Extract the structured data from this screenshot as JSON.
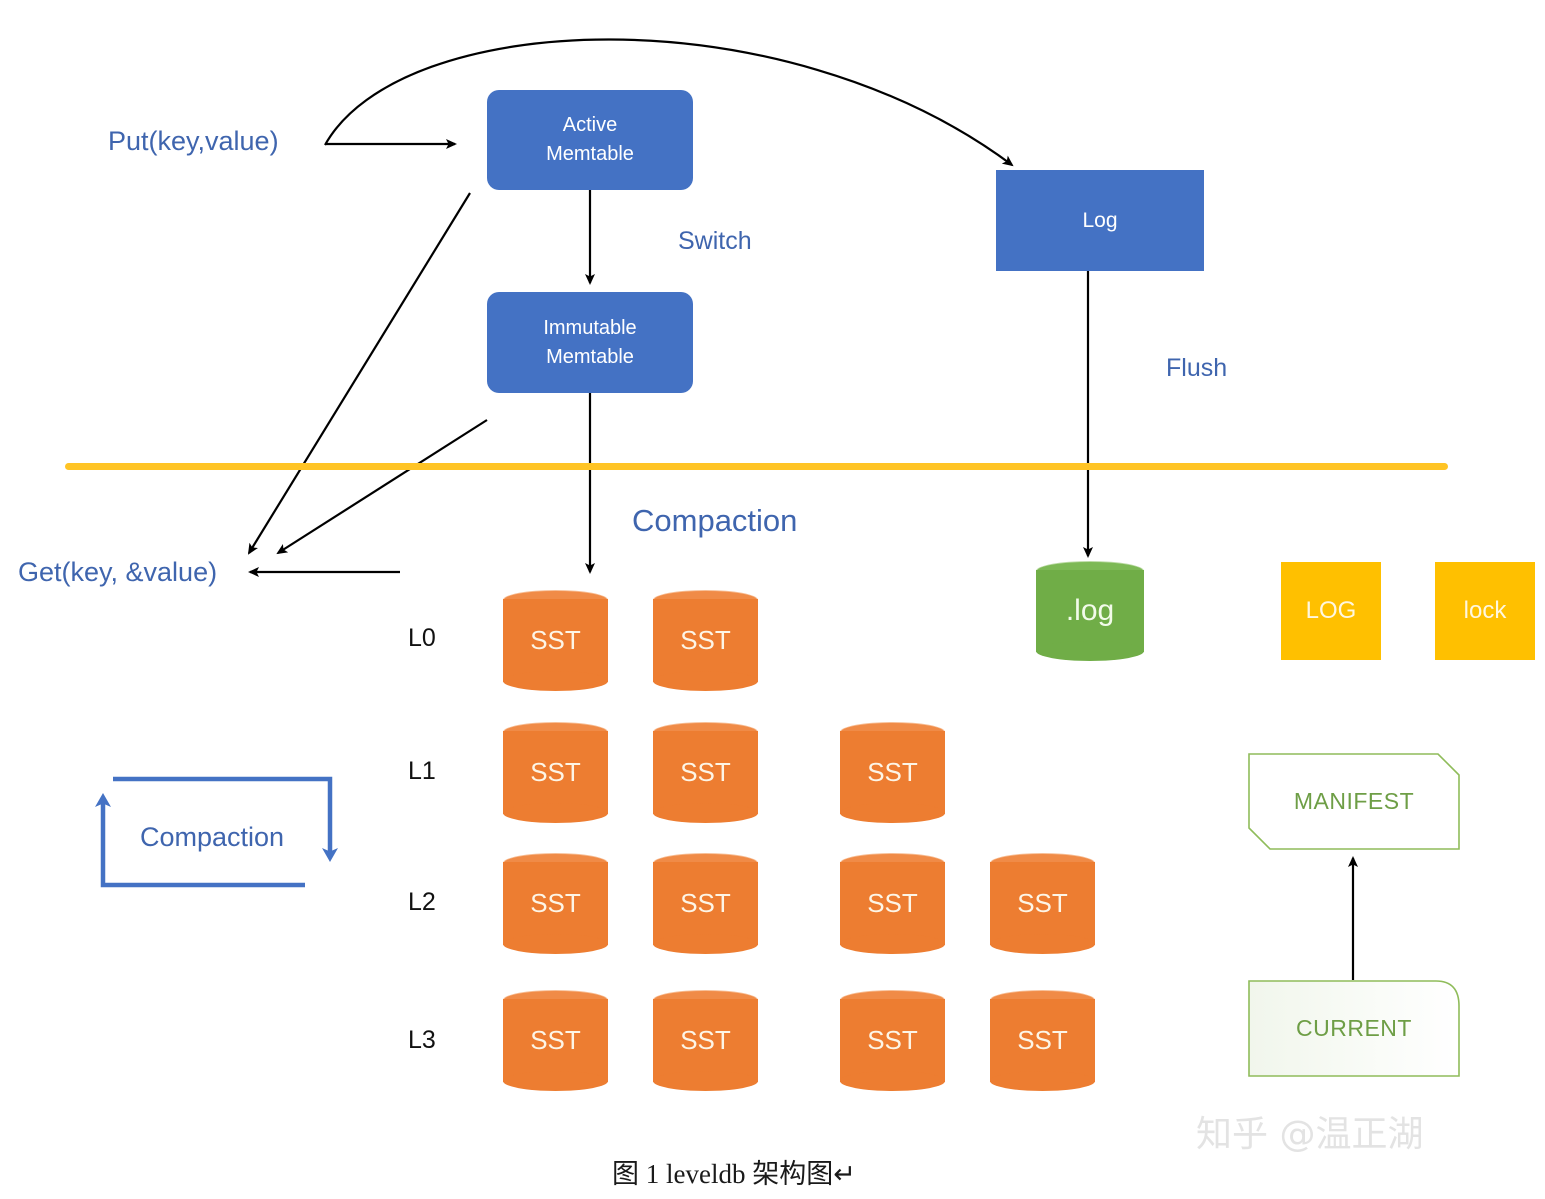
{
  "diagram": {
    "caption": "图 1  leveldb 架构图↵",
    "watermark": "知乎 @温正湖",
    "colors": {
      "memtable_blue": "#4472C4",
      "label_blue": "#3F65AE",
      "sst_orange": "#ED7D31",
      "log_green": "#70AD47",
      "file_yellow": "#FFC000",
      "divider_yellow": "#FFC425",
      "doc_outline_green": "#6E9E46",
      "arrow_black": "#000000"
    },
    "labels": {
      "put": "Put(key,value)",
      "get": "Get(key, &value)",
      "switch": "Switch",
      "flush": "Flush",
      "compaction_title": "Compaction",
      "compaction_legend": "Compaction"
    },
    "boxes": {
      "active_memtable": "Active\nMemtable",
      "immutable_memtable": "Immutable\nMemtable",
      "log": "Log"
    },
    "files": {
      "log_cylinder": ".log",
      "log_file": "LOG",
      "lock_file": "lock",
      "manifest": "MANIFEST",
      "current": "CURRENT"
    },
    "levels": [
      {
        "label": "L0",
        "count": 2
      },
      {
        "label": "L1",
        "count": 3
      },
      {
        "label": "L2",
        "count": 4
      },
      {
        "label": "L3",
        "count": 4
      }
    ],
    "sst_label": "SST"
  }
}
